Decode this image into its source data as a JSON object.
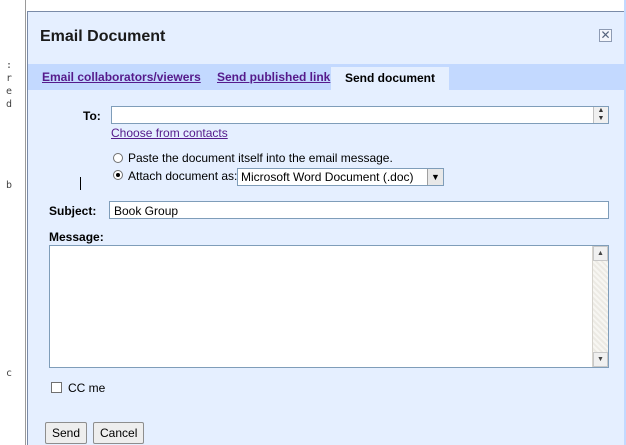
{
  "dialog": {
    "title": "Email Document",
    "close_glyph": "✕"
  },
  "tabs": [
    {
      "label": "Email collaborators/viewers",
      "active": false
    },
    {
      "label": "Send published link",
      "active": false
    },
    {
      "label": "Send document",
      "active": true
    }
  ],
  "to": {
    "label": "To:",
    "value": "",
    "choose_contacts": "Choose from contacts"
  },
  "options": {
    "paste": "Paste the document itself into the email message.",
    "attach": "Attach document as:",
    "selected": "attach",
    "attach_format": "Microsoft Word Document (.doc)"
  },
  "subject": {
    "label": "Subject:",
    "value": "Book Group"
  },
  "message": {
    "label": "Message:",
    "value": ""
  },
  "cc": {
    "label": "CC me",
    "checked": false
  },
  "buttons": {
    "send": "Send",
    "cancel": "Cancel"
  },
  "icons": {
    "close": "close-icon",
    "spin": "spinner-icon",
    "dropdown": "chevron-down-icon",
    "scroll_up": "scroll-up-icon",
    "scroll_down": "scroll-down-icon"
  }
}
